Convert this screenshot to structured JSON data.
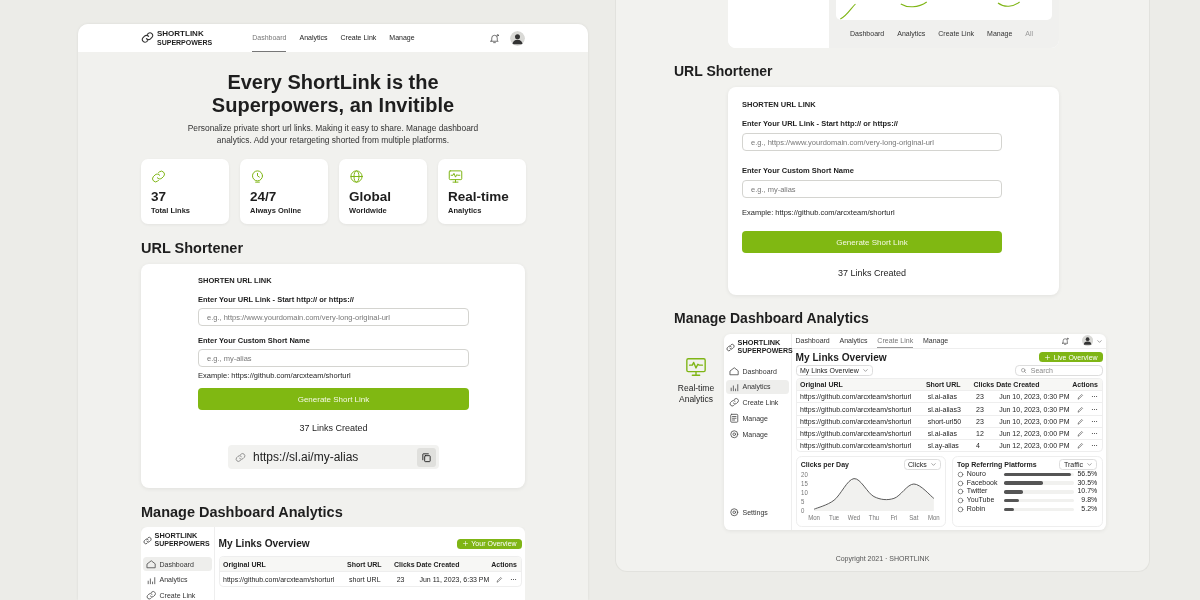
{
  "left_panel": {
    "header": {
      "logo": {
        "line1": "SHORTLINK",
        "line2": "SUPERPOWERS"
      },
      "nav": [
        {
          "label": "Dashboard",
          "selected": true
        },
        {
          "label": "Analytics",
          "selected": false
        },
        {
          "label": "Create Link",
          "selected": false
        },
        {
          "label": "Manage",
          "selected": false
        }
      ]
    },
    "hero": {
      "title_lines": [
        "Every ShortLink is the",
        "Superpowers, an Invitible"
      ],
      "subtitle_lines": [
        "Personalize private short url links. Making it easy to share. Manage dashboard",
        "analytics. Add your retargeting shorted from multiple platforms."
      ]
    },
    "stats": [
      {
        "kind": "links",
        "value": "37",
        "label": "Total Links"
      },
      {
        "kind": "uptime",
        "value": "24/7",
        "label": "Always Online"
      },
      {
        "kind": "global",
        "value": "Global",
        "label": "Worldwide"
      },
      {
        "kind": "realtime",
        "value": "Real-time",
        "label": "Analytics"
      }
    ],
    "shortener": {
      "heading": "URL Shortener",
      "card_title": "SHORTEN URL LINK",
      "url_label": "Enter Your URL Link - Start http:// or https://",
      "url_placeholder": "e.g., https://www.yourdomain.com/very-long-original-url",
      "name_label": "Enter Your Custom Short Name",
      "name_placeholder": "e.g., my-alias",
      "example_label": "Example:",
      "example_url": "https://github.com/arcxteam/shorturl",
      "button": "Generate Short Link",
      "count": "37 Links Created",
      "result": "https://sl.ai/my-alias"
    },
    "analytics": {
      "heading": "Manage Dashboard Analytics",
      "dashboard": {
        "logo": {
          "line1": "SHORTLINK",
          "line2": "SUPERPOWERS"
        },
        "sidebar": [
          {
            "kind": "home",
            "label": "Dashboard",
            "selected": true
          },
          {
            "kind": "chart",
            "label": "Analytics",
            "selected": false
          },
          {
            "kind": "link",
            "label": "Create Link",
            "selected": false
          }
        ],
        "title": "My Links Overview",
        "button": "Your Overview",
        "columns": [
          "Original URL",
          "Short URL",
          "Clicks",
          "Date Created",
          "Actions"
        ],
        "rows": [
          {
            "original_url": "https://github.com/arcxteam/shorturl",
            "short_url": "short URL",
            "clicks": "23",
            "date": "Jun 11, 2023, 6:33 PM"
          }
        ]
      }
    }
  },
  "right_panel": {
    "top_nav": [
      {
        "label": "Dashboard",
        "disabled": false
      },
      {
        "label": "Analytics",
        "disabled": false
      },
      {
        "label": "Create Link",
        "disabled": false
      },
      {
        "label": "Manage",
        "disabled": false
      },
      {
        "label": "All",
        "disabled": true
      }
    ],
    "shortener": {
      "heading": "URL Shortener",
      "card_title": "SHORTEN URL LINK",
      "url_label": "Enter Your URL Link - Start http:// or https://",
      "url_placeholder": "e.g., https://www.yourdomain.com/very-long-original-url",
      "name_label": "Enter Your Custom Short Name",
      "name_placeholder": "e.g., my-alias",
      "example_label": "Example:",
      "example_url": "https://github.com/arcxteam/shorturl",
      "button": "Generate Short Link",
      "count": "37 Links Created"
    },
    "analytics": {
      "heading": "Manage Dashboard Analytics",
      "feature": {
        "title_lines": [
          "Real-time",
          "Analytics"
        ]
      },
      "dashboard": {
        "logo": {
          "line1": "SHORTLINK",
          "line2": "SUPERPOWERS"
        },
        "top_nav": [
          {
            "label": "Dashboard",
            "selected": false
          },
          {
            "label": "Analytics",
            "selected": false
          },
          {
            "label": "Create Link",
            "selected": true
          },
          {
            "label": "Manage",
            "selected": false
          }
        ],
        "sidebar": [
          {
            "kind": "home",
            "label": "Dashboard",
            "selected": false
          },
          {
            "kind": "chart",
            "label": "Analytics",
            "selected": true
          },
          {
            "kind": "link",
            "label": "Create Link",
            "selected": false
          },
          {
            "kind": "file",
            "label": "Manage",
            "selected": false
          },
          {
            "kind": "gear",
            "label": "Manage",
            "selected": false
          }
        ],
        "settings": "Settings",
        "title": "My Links Overview",
        "button": "Live Overview",
        "filter": "My Links Overview",
        "search_placeholder": "Search",
        "columns": [
          "Original URL",
          "Short URL",
          "Clicks",
          "Date Created",
          "Actions"
        ],
        "rows": [
          {
            "original_url": "https://github.com/arcxteam/shorturl",
            "short_url": "sl.ai-alias",
            "clicks": "23",
            "date": "Jun 10, 2023, 0:30 PM"
          },
          {
            "original_url": "https://github.com/arcxteam/shorturl",
            "short_url": "sl.ai-alias3",
            "clicks": "23",
            "date": "Jun 10, 2023, 0:30 PM"
          },
          {
            "original_url": "https://github.com/arcxteam/shorturl",
            "short_url": "short-url50",
            "clicks": "23",
            "date": "Jun 10, 2023, 0:00 PM"
          },
          {
            "original_url": "https://github.com/arcxteam/shorturl",
            "short_url": "sl.ai-alias",
            "clicks": "12",
            "date": "Jun 12, 2023, 0:00 PM"
          },
          {
            "original_url": "https://github.com/arcxteam/shorturl",
            "short_url": "sl.ay-alias",
            "clicks": "4",
            "date": "Jun 12, 2023, 0:00 PM"
          }
        ],
        "clicks_chart": {
          "chart_data": {
            "type": "area",
            "title": "Clicks per Day",
            "categories": [
              "Mon",
              "Tue",
              "Wed",
              "Thu",
              "Fri",
              "Sat",
              "Mon"
            ],
            "ylim": [
              0,
              20
            ],
            "yticks": [
              0,
              5,
              10,
              15,
              20
            ],
            "series": [
              {
                "name": "Clicks",
                "color": "#555555",
                "values": [
                  1,
                  6,
                  18,
                  8,
                  7,
                  15,
                  7
                ]
              }
            ]
          }
        },
        "platforms": {
          "title": "Top Referring Platforms",
          "select": "Traffic",
          "items": [
            {
              "name": "Nouro",
              "percent": "56.5%",
              "level": 0.95
            },
            {
              "name": "Facebook",
              "percent": "30.5%",
              "level": 0.55
            },
            {
              "name": "Twitter",
              "percent": "10.7%",
              "level": 0.27
            },
            {
              "name": "YouTube",
              "percent": "9.8%",
              "level": 0.22
            },
            {
              "name": "Robin",
              "percent": "5.2%",
              "level": 0.15
            }
          ]
        }
      }
    },
    "footer": "Copyright 2021 · SHORTLINK"
  }
}
